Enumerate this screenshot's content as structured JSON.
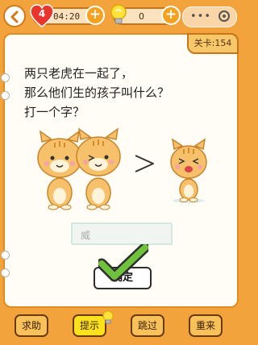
{
  "topbar": {
    "lives": "4",
    "timer": "04:20",
    "hints": "0",
    "plus_label": "+"
  },
  "level": {
    "label": "关卡:154"
  },
  "question": {
    "lines": [
      "两只老虎在一起了，",
      "那么他们生的孩子叫什么？",
      "打一个字？"
    ]
  },
  "answer": {
    "value": "威"
  },
  "confirm": {
    "label": "确定"
  },
  "bottom": {
    "help": "求助",
    "hint": "提示",
    "skip": "跳过",
    "restart": "重来"
  },
  "colors": {
    "background": "#f2a33c",
    "accent": "#e08a22",
    "check": "#6fc23c"
  }
}
